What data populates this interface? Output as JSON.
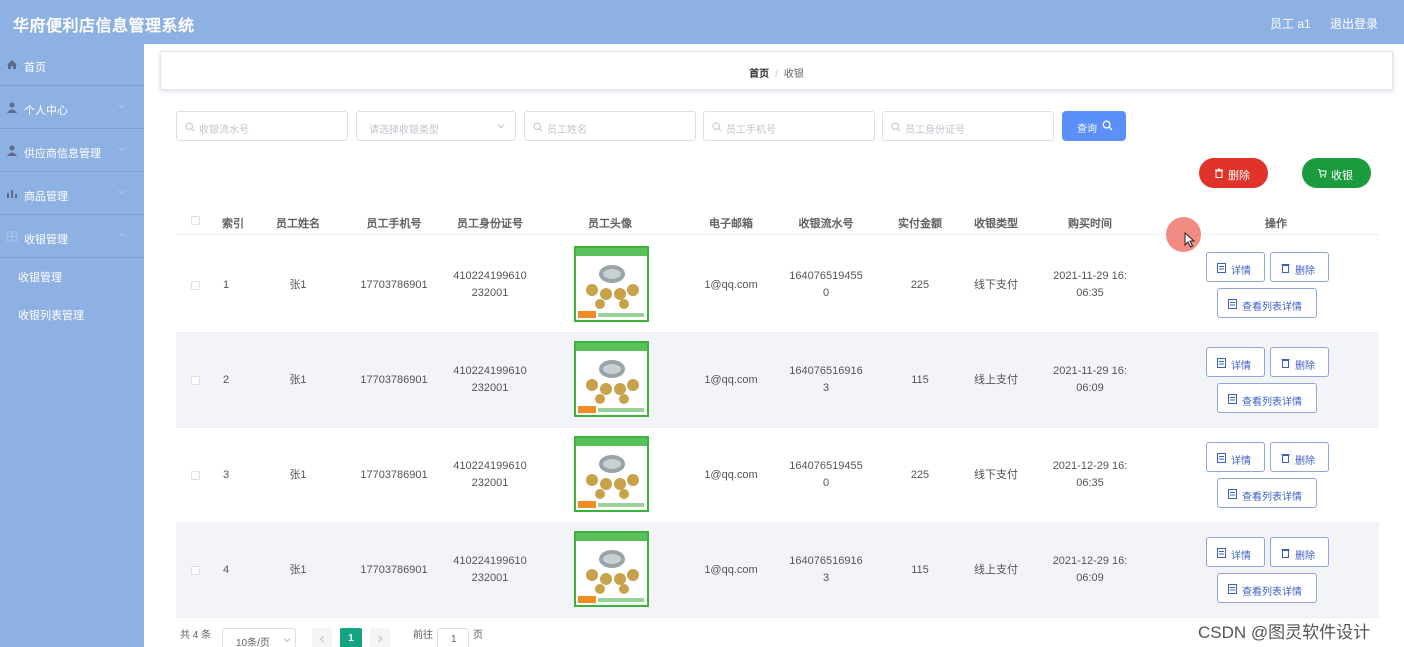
{
  "app": {
    "title": "华府便利店信息管理系统",
    "user": "员工 a1",
    "logout": "退出登录"
  },
  "sidebar": {
    "items": [
      {
        "label": "首页",
        "icon": "home-icon"
      },
      {
        "label": "个人中心",
        "icon": "user-icon"
      },
      {
        "label": "供应商信息管理",
        "icon": "user-icon"
      },
      {
        "label": "商品管理",
        "icon": "chart-icon"
      },
      {
        "label": "收银管理",
        "icon": "grid-icon"
      }
    ],
    "sub_items": [
      {
        "label": "收银管理"
      },
      {
        "label": "收银列表管理"
      }
    ]
  },
  "breadcrumb": {
    "home": "首页",
    "sep": "/",
    "current": "收银"
  },
  "filters": {
    "serial_placeholder": "收银流水号",
    "type_placeholder": "请选择收银类型",
    "name_placeholder": "员工姓名",
    "phone_placeholder": "员工手机号",
    "id_placeholder": "员工身份证号",
    "search_label": "查询"
  },
  "toolbar": {
    "delete_label": "删除",
    "checkout_label": "收银"
  },
  "table": {
    "headers": {
      "index": "索引",
      "name": "员工姓名",
      "phone": "员工手机号",
      "idcard": "员工身份证号",
      "avatar": "员工头像",
      "email": "电子邮箱",
      "serial": "收银流水号",
      "amount": "实付金额",
      "type": "收银类型",
      "time": "购买时间",
      "ops": "操作"
    },
    "rows": [
      {
        "index": "1",
        "name": "张1",
        "phone": "17703786901",
        "id1": "410224199610",
        "id2": "232001",
        "email": "1@qq.com",
        "s1": "164076519455",
        "s2": "0",
        "amount": "225",
        "type": "线下支付",
        "t1": "2021-11-29 16:",
        "t2": "06:35"
      },
      {
        "index": "2",
        "name": "张1",
        "phone": "17703786901",
        "id1": "410224199610",
        "id2": "232001",
        "email": "1@qq.com",
        "s1": "164076516916",
        "s2": "3",
        "amount": "115",
        "type": "线上支付",
        "t1": "2021-11-29 16:",
        "t2": "06:09"
      },
      {
        "index": "3",
        "name": "张1",
        "phone": "17703786901",
        "id1": "410224199610",
        "id2": "232001",
        "email": "1@qq.com",
        "s1": "164076519455",
        "s2": "0",
        "amount": "225",
        "type": "线下支付",
        "t1": "2021-12-29 16:",
        "t2": "06:35"
      },
      {
        "index": "4",
        "name": "张1",
        "phone": "17703786901",
        "id1": "410224199610",
        "id2": "232001",
        "email": "1@qq.com",
        "s1": "164076516916",
        "s2": "3",
        "amount": "115",
        "type": "线上支付",
        "t1": "2021-12-29 16:",
        "t2": "06:09"
      }
    ],
    "actions": {
      "detail": "详情",
      "delete": "删除",
      "list_detail": "查看列表详情"
    }
  },
  "pagination": {
    "total": "共 4 条",
    "page_size": "10条/页",
    "current": "1",
    "goto": "前往",
    "goto_value": "1",
    "page_suffix": "页"
  },
  "watermark": "CSDN @图灵软件设计",
  "colors": {
    "header": "#8eb1e3",
    "primary": "#5b8ff9",
    "danger": "#e0342a",
    "success": "#1c9b3e",
    "pager_active": "#14a37f"
  }
}
